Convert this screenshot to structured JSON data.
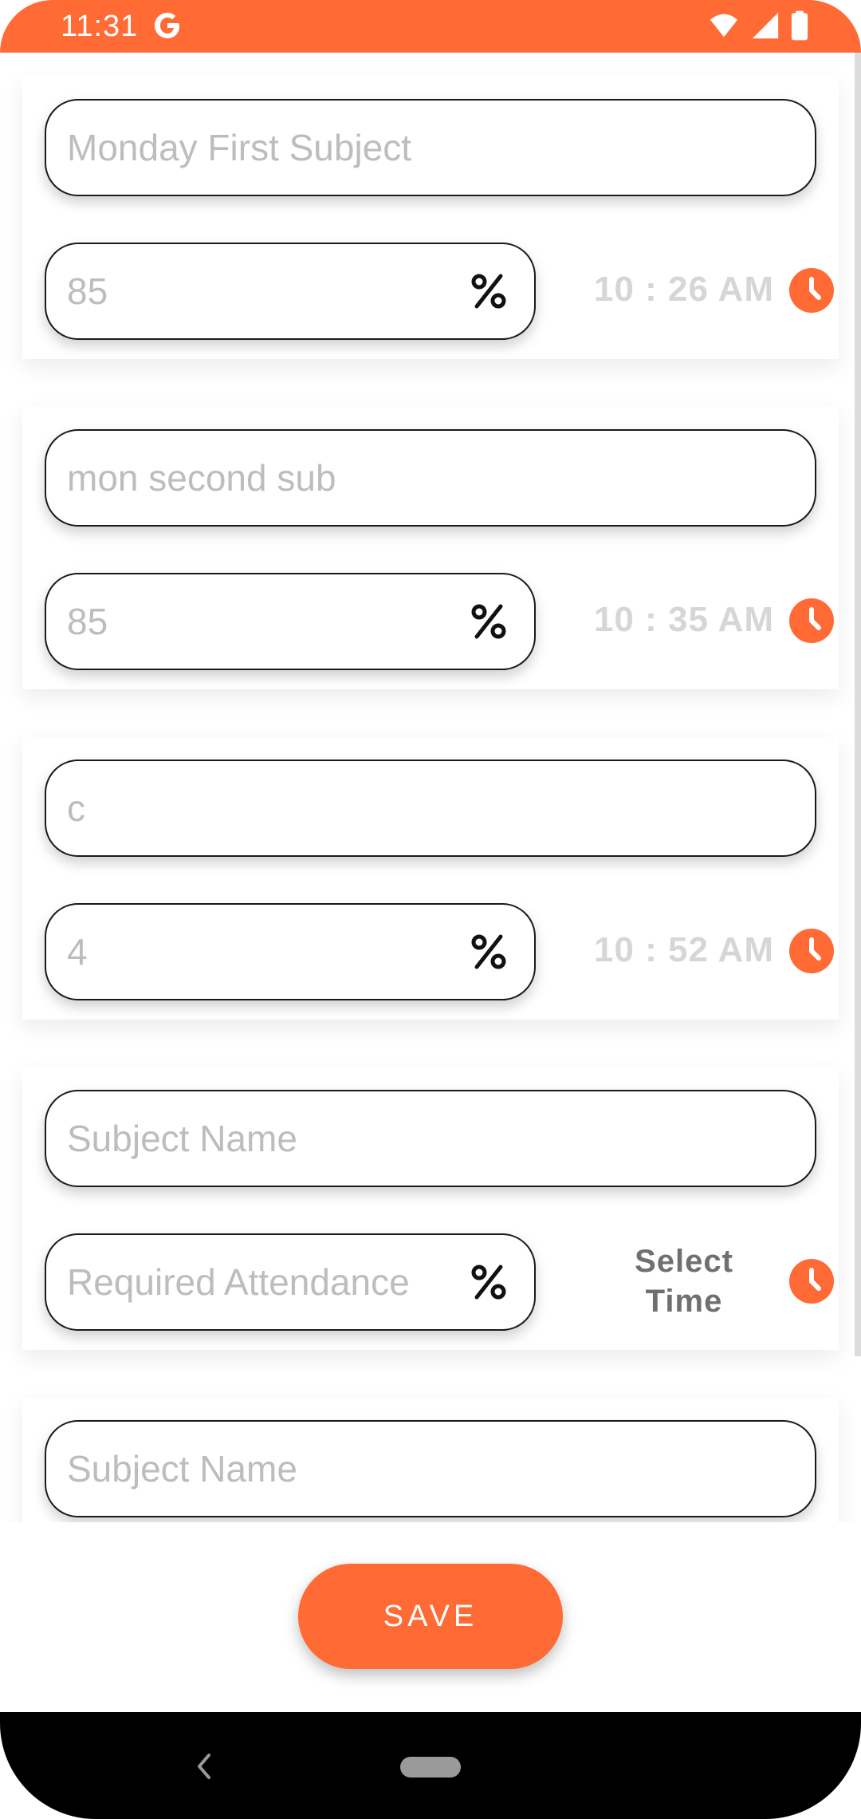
{
  "status_bar": {
    "time": "11:31",
    "color": "#FF6A35",
    "icons": [
      "google-icon",
      "wifi-icon",
      "signal-icon",
      "battery-icon"
    ]
  },
  "subjects": [
    {
      "name_value": "Monday First Subject",
      "attendance_value": "85",
      "time": "10 : 26 AM"
    },
    {
      "name_value": "mon second sub",
      "attendance_value": "85",
      "time": "10 : 35 AM"
    },
    {
      "name_value": "c",
      "attendance_value": "4",
      "time": "10 : 52 AM"
    },
    {
      "name_placeholder": "Subject Name",
      "attendance_placeholder": "Required Attendance",
      "time_placeholder_line1": "Select",
      "time_placeholder_line2": "Time"
    },
    {
      "name_placeholder": "Subject Name"
    }
  ],
  "save_button": {
    "label": "SAVE"
  },
  "colors": {
    "accent": "#FF6A35",
    "field_text": "#bdbdbd",
    "time_text": "#d6d6d6"
  }
}
